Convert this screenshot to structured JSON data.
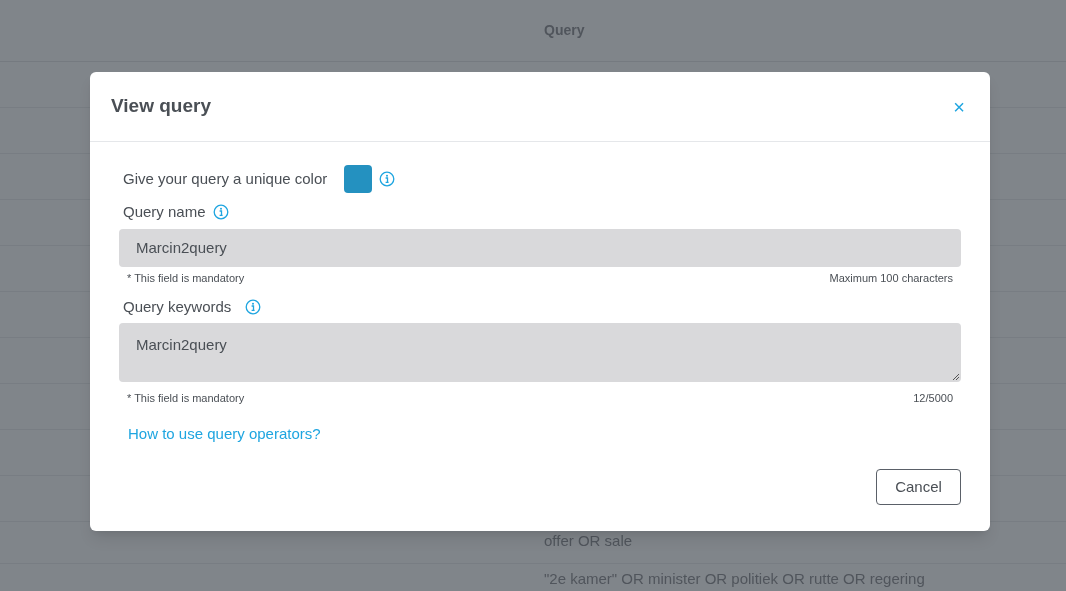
{
  "background_table": {
    "column_header": "Query",
    "rows": [
      "offer OR sale",
      "\"2e kamer\" OR minister OR politiek OR rutte OR regering"
    ]
  },
  "dialog": {
    "title": "View query",
    "close": "×",
    "color_label": "Give your query a unique color",
    "color": "#2491c0",
    "name_label": "Query name",
    "name_value": "Marcin2query",
    "name_hint": "* This field is mandatory",
    "name_limit": "Maximum 100 characters",
    "keywords_label": "Query keywords",
    "keywords_value": "Marcin2query",
    "keywords_hint": "* This field is mandatory",
    "keywords_count": "12/5000",
    "help_link": "How to use query operators?",
    "buttons": [
      "Cancel"
    ]
  }
}
